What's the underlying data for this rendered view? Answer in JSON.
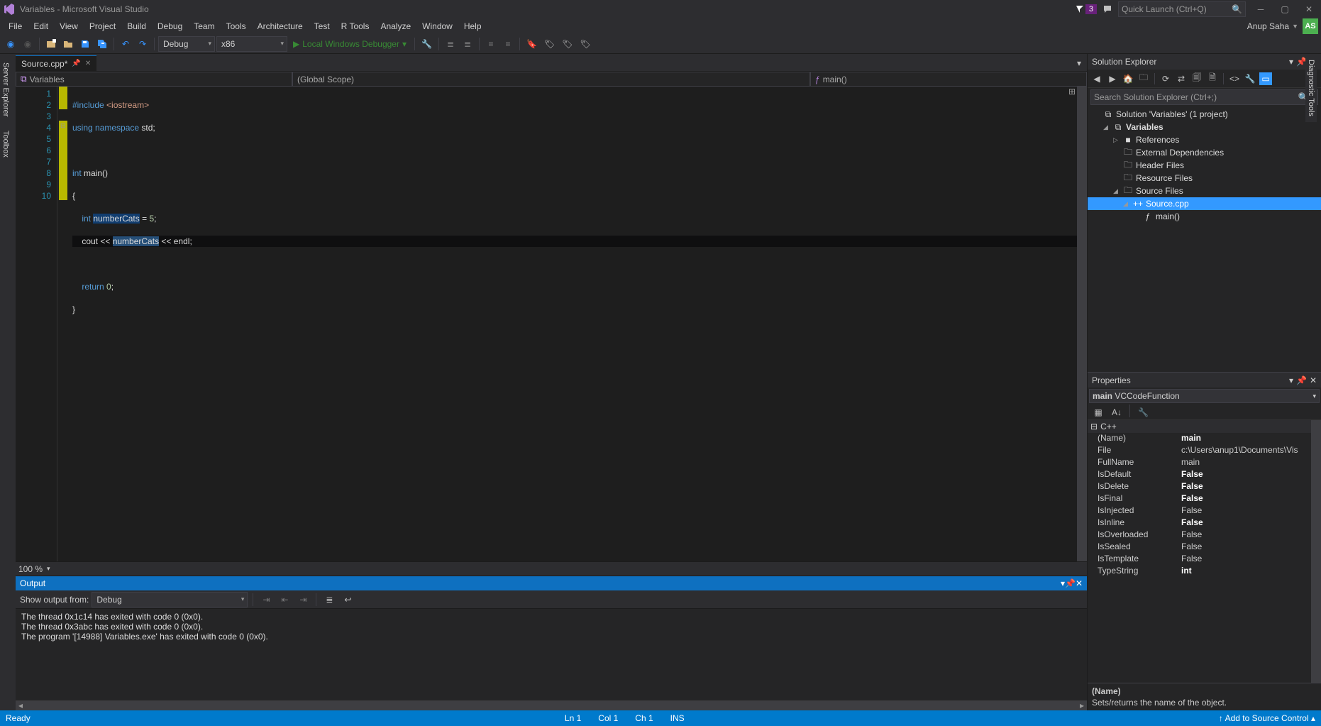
{
  "titlebar": {
    "title": "Variables - Microsoft Visual Studio",
    "notifications_count": "3",
    "search_placeholder": "Quick Launch (Ctrl+Q)",
    "user_name": "Anup Saha",
    "user_initials": "AS"
  },
  "menubar": {
    "items": [
      "File",
      "Edit",
      "View",
      "Project",
      "Build",
      "Debug",
      "Team",
      "Tools",
      "Architecture",
      "Test",
      "R Tools",
      "Analyze",
      "Window",
      "Help"
    ]
  },
  "toolbar": {
    "config": "Debug",
    "platform": "x86",
    "start_label": "Local Windows Debugger"
  },
  "left_tabs": [
    "Server Explorer",
    "Toolbox"
  ],
  "right_tab": "Diagnostic Tools",
  "editor": {
    "tab_label": "Source.cpp*",
    "nav_left": "Variables",
    "nav_scope": "(Global Scope)",
    "nav_member": "main()",
    "zoom": "100 %",
    "lines": [
      {
        "n": "1",
        "raw": "#include <iostream>"
      },
      {
        "n": "2",
        "raw": "using namespace std;"
      },
      {
        "n": "3",
        "raw": ""
      },
      {
        "n": "4",
        "raw": "int main()"
      },
      {
        "n": "5",
        "raw": "{"
      },
      {
        "n": "6",
        "raw": "    int numberCats = 5;"
      },
      {
        "n": "7",
        "raw": "    cout << numberCats << endl;"
      },
      {
        "n": "8",
        "raw": ""
      },
      {
        "n": "9",
        "raw": "    return 0;"
      },
      {
        "n": "10",
        "raw": "}"
      }
    ]
  },
  "solution_explorer": {
    "title": "Solution Explorer",
    "search_placeholder": "Search Solution Explorer (Ctrl+;)",
    "items": [
      {
        "indent": 0,
        "exp": "",
        "icon": "⧉",
        "label": "Solution 'Variables' (1 project)"
      },
      {
        "indent": 1,
        "exp": "◢",
        "icon": "⧉",
        "label": "Variables",
        "bold": true
      },
      {
        "indent": 2,
        "exp": "▷",
        "icon": "■",
        "label": "References"
      },
      {
        "indent": 2,
        "exp": "",
        "icon": "🗀",
        "label": "External Dependencies"
      },
      {
        "indent": 2,
        "exp": "",
        "icon": "🗀",
        "label": "Header Files"
      },
      {
        "indent": 2,
        "exp": "",
        "icon": "🗀",
        "label": "Resource Files"
      },
      {
        "indent": 2,
        "exp": "◢",
        "icon": "🗀",
        "label": "Source Files"
      },
      {
        "indent": 3,
        "exp": "◢",
        "icon": "++",
        "label": "Source.cpp",
        "selected": true
      },
      {
        "indent": 4,
        "exp": "",
        "icon": "ƒ",
        "label": "main()"
      }
    ]
  },
  "properties": {
    "title": "Properties",
    "object": "main VCCodeFunction",
    "category": "C++",
    "rows": [
      {
        "k": "(Name)",
        "v": "main",
        "bold": true
      },
      {
        "k": "File",
        "v": "c:\\Users\\anup1\\Documents\\Vis",
        "bold": false
      },
      {
        "k": "FullName",
        "v": "main",
        "bold": false
      },
      {
        "k": "IsDefault",
        "v": "False",
        "bold": true
      },
      {
        "k": "IsDelete",
        "v": "False",
        "bold": true
      },
      {
        "k": "IsFinal",
        "v": "False",
        "bold": true
      },
      {
        "k": "IsInjected",
        "v": "False",
        "bold": false
      },
      {
        "k": "IsInline",
        "v": "False",
        "bold": true
      },
      {
        "k": "IsOverloaded",
        "v": "False",
        "bold": false
      },
      {
        "k": "IsSealed",
        "v": "False",
        "bold": false
      },
      {
        "k": "IsTemplate",
        "v": "False",
        "bold": false
      },
      {
        "k": "TypeString",
        "v": "int",
        "bold": true
      }
    ],
    "desc_title": "(Name)",
    "desc_text": "Sets/returns the name of the object."
  },
  "output": {
    "title": "Output",
    "source_label": "Show output from:",
    "source_value": "Debug",
    "lines": [
      "The thread 0x1c14 has exited with code 0 (0x0).",
      "The thread 0x3abc has exited with code 0 (0x0).",
      "The program '[14988] Variables.exe' has exited with code 0 (0x0)."
    ]
  },
  "statusbar": {
    "ready": "Ready",
    "ln": "Ln 1",
    "col": "Col 1",
    "ch": "Ch 1",
    "ins": "INS",
    "scm": "Add to Source Control"
  }
}
